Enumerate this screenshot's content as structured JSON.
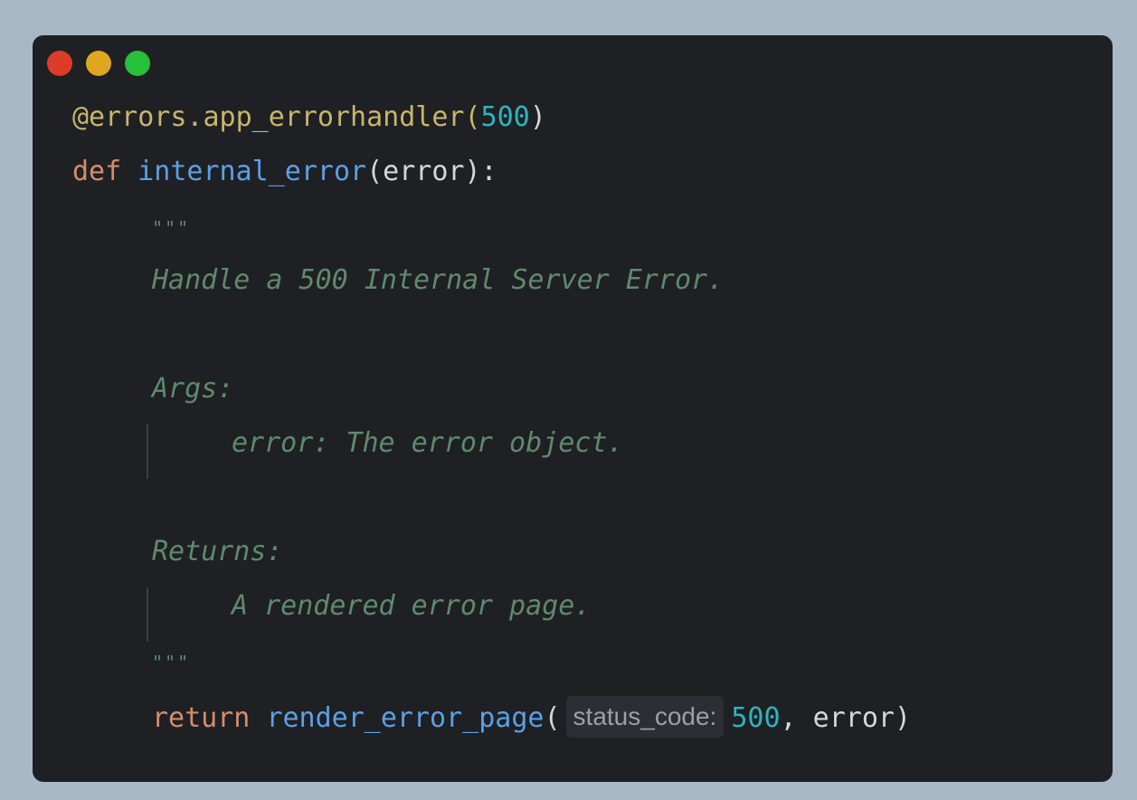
{
  "window": {
    "colors": {
      "close": "#de3b2a",
      "minimize": "#dfa61f",
      "maximize": "#25c13a"
    }
  },
  "code": {
    "decorator": "@errors.app_errorhandler(",
    "decorator_arg": "500",
    "decorator_close": ")",
    "def_kw": "def",
    "func_name": "internal_error",
    "params": "(error):",
    "docstring_open": "\"\"\"",
    "doc_summary": "Handle a 500 Internal Server Error.",
    "doc_args_header": "Args:",
    "doc_args_item": "error: The error object.",
    "doc_returns_header": "Returns:",
    "doc_returns_item": "A rendered error page.",
    "docstring_close": "\"\"\"",
    "return_kw": "return",
    "call_name": "render_error_page",
    "call_open": "(",
    "inlay_hint": "status_code:",
    "call_arg_num": "500",
    "call_rest": ", error)"
  }
}
